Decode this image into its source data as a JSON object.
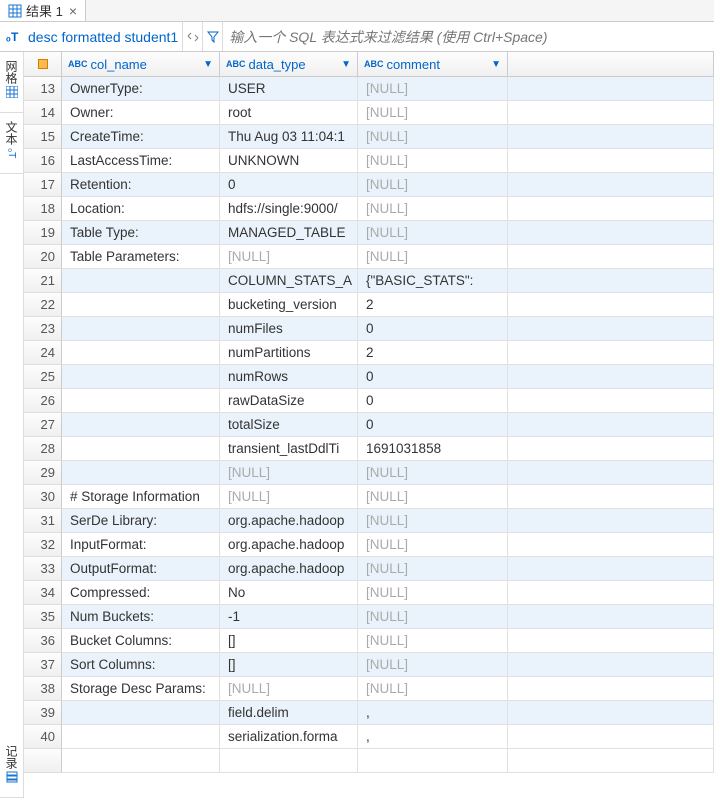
{
  "tab": {
    "title": "结果 1"
  },
  "filter": {
    "prefix_icon": "₀T",
    "query": "desc formatted student1",
    "placeholder": "输入一个 SQL 表达式来过滤结果 (使用 Ctrl+Space)"
  },
  "rail": {
    "item1": "网格",
    "item2": "文本",
    "item3": "记录"
  },
  "columns": {
    "c1_type": "ABC",
    "c1": "col_name",
    "c2_type": "ABC",
    "c2": "data_type",
    "c3_type": "ABC",
    "c3": "comment"
  },
  "rows": [
    {
      "n": "13",
      "c1": "OwnerType:",
      "c2": "USER",
      "c3": "[NULL]",
      "n1": false,
      "n2": false,
      "n3": true
    },
    {
      "n": "14",
      "c1": "Owner:",
      "c2": "root",
      "c3": "[NULL]",
      "n1": false,
      "n2": false,
      "n3": true
    },
    {
      "n": "15",
      "c1": "CreateTime:",
      "c2": "Thu Aug 03 11:04:1",
      "c3": "[NULL]",
      "n1": false,
      "n2": false,
      "n3": true
    },
    {
      "n": "16",
      "c1": "LastAccessTime:",
      "c2": "UNKNOWN",
      "c3": "[NULL]",
      "n1": false,
      "n2": false,
      "n3": true
    },
    {
      "n": "17",
      "c1": "Retention:",
      "c2": "0",
      "c3": "[NULL]",
      "n1": false,
      "n2": false,
      "n3": true
    },
    {
      "n": "18",
      "c1": "Location:",
      "c2": "hdfs://single:9000/",
      "c3": "[NULL]",
      "n1": false,
      "n2": false,
      "n3": true
    },
    {
      "n": "19",
      "c1": "Table Type:",
      "c2": "MANAGED_TABLE",
      "c3": "[NULL]",
      "n1": false,
      "n2": false,
      "n3": true
    },
    {
      "n": "20",
      "c1": "Table Parameters:",
      "c2": "[NULL]",
      "c3": "[NULL]",
      "n1": false,
      "n2": true,
      "n3": true
    },
    {
      "n": "21",
      "c1": "",
      "c2": "COLUMN_STATS_A",
      "c3": "{\"BASIC_STATS\":",
      "n1": false,
      "n2": false,
      "n3": false
    },
    {
      "n": "22",
      "c1": "",
      "c2": "bucketing_version",
      "c3": "2",
      "n1": false,
      "n2": false,
      "n3": false
    },
    {
      "n": "23",
      "c1": "",
      "c2": "numFiles",
      "c3": "0",
      "n1": false,
      "n2": false,
      "n3": false
    },
    {
      "n": "24",
      "c1": "",
      "c2": "numPartitions",
      "c3": "2",
      "n1": false,
      "n2": false,
      "n3": false
    },
    {
      "n": "25",
      "c1": "",
      "c2": "numRows",
      "c3": "0",
      "n1": false,
      "n2": false,
      "n3": false
    },
    {
      "n": "26",
      "c1": "",
      "c2": "rawDataSize",
      "c3": "0",
      "n1": false,
      "n2": false,
      "n3": false
    },
    {
      "n": "27",
      "c1": "",
      "c2": "totalSize",
      "c3": "0",
      "n1": false,
      "n2": false,
      "n3": false
    },
    {
      "n": "28",
      "c1": "",
      "c2": "transient_lastDdlTi",
      "c3": "1691031858",
      "n1": false,
      "n2": false,
      "n3": false
    },
    {
      "n": "29",
      "c1": "",
      "c2": "[NULL]",
      "c3": "[NULL]",
      "n1": false,
      "n2": true,
      "n3": true
    },
    {
      "n": "30",
      "c1": "# Storage Information",
      "c2": "[NULL]",
      "c3": "[NULL]",
      "n1": false,
      "n2": true,
      "n3": true
    },
    {
      "n": "31",
      "c1": "SerDe Library:",
      "c2": "org.apache.hadoop",
      "c3": "[NULL]",
      "n1": false,
      "n2": false,
      "n3": true
    },
    {
      "n": "32",
      "c1": "InputFormat:",
      "c2": "org.apache.hadoop",
      "c3": "[NULL]",
      "n1": false,
      "n2": false,
      "n3": true
    },
    {
      "n": "33",
      "c1": "OutputFormat:",
      "c2": "org.apache.hadoop",
      "c3": "[NULL]",
      "n1": false,
      "n2": false,
      "n3": true
    },
    {
      "n": "34",
      "c1": "Compressed:",
      "c2": "No",
      "c3": "[NULL]",
      "n1": false,
      "n2": false,
      "n3": true
    },
    {
      "n": "35",
      "c1": "Num Buckets:",
      "c2": "-1",
      "c3": "[NULL]",
      "n1": false,
      "n2": false,
      "n3": true
    },
    {
      "n": "36",
      "c1": "Bucket Columns:",
      "c2": "[]",
      "c3": "[NULL]",
      "n1": false,
      "n2": false,
      "n3": true
    },
    {
      "n": "37",
      "c1": "Sort Columns:",
      "c2": "[]",
      "c3": "[NULL]",
      "n1": false,
      "n2": false,
      "n3": true
    },
    {
      "n": "38",
      "c1": "Storage Desc Params:",
      "c2": "[NULL]",
      "c3": "[NULL]",
      "n1": false,
      "n2": true,
      "n3": true
    },
    {
      "n": "39",
      "c1": "",
      "c2": "field.delim",
      "c3": ",",
      "n1": false,
      "n2": false,
      "n3": false
    },
    {
      "n": "40",
      "c1": "",
      "c2": "serialization.forma",
      "c3": ",",
      "n1": false,
      "n2": false,
      "n3": false
    }
  ]
}
